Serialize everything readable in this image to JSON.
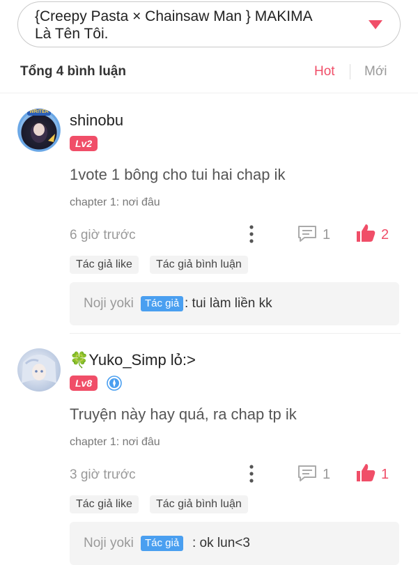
{
  "story_title": "{Creepy Pasta × Chainsaw Man } MAKIMA\nLà Tên Tôi.",
  "header": {
    "total_label": "Tổng 4 bình luận",
    "sort_hot": "Hot",
    "sort_new": "Mới"
  },
  "colors": {
    "accent": "#f04e68",
    "author_badge": "#4a9ff0",
    "reply_bg": "#f4f4f4"
  },
  "comments": [
    {
      "username": "shinobu",
      "level": "Lv2",
      "level_color": "#f04e68",
      "avatar_badge": "WRITER",
      "content": "1vote 1 bông cho tui hai chap ik",
      "chapter": "chapter 1: nơi đâu",
      "time": "6 giờ trước",
      "reply_count": "1",
      "like_count": "2",
      "tags": [
        "Tác giả like",
        "Tác giả bình luận"
      ],
      "author_reply": {
        "author": "Noji yoki",
        "badge": "Tác giả",
        "text": ": tui làm liền kk"
      }
    },
    {
      "username": "🍀Yuko_Simp lỏ:>",
      "level": "Lv8",
      "level_color": "#f04e68",
      "content": "Truyện này hay quá, ra chap tp ik",
      "chapter": "chapter 1: nơi đâu",
      "time": "3 giờ trước",
      "reply_count": "1",
      "like_count": "1",
      "tags": [
        "Tác giả like",
        "Tác giả bình luận"
      ],
      "author_reply": {
        "author": "Noji yoki",
        "badge": "Tác giả",
        "text": ": ok lun<3"
      }
    }
  ]
}
